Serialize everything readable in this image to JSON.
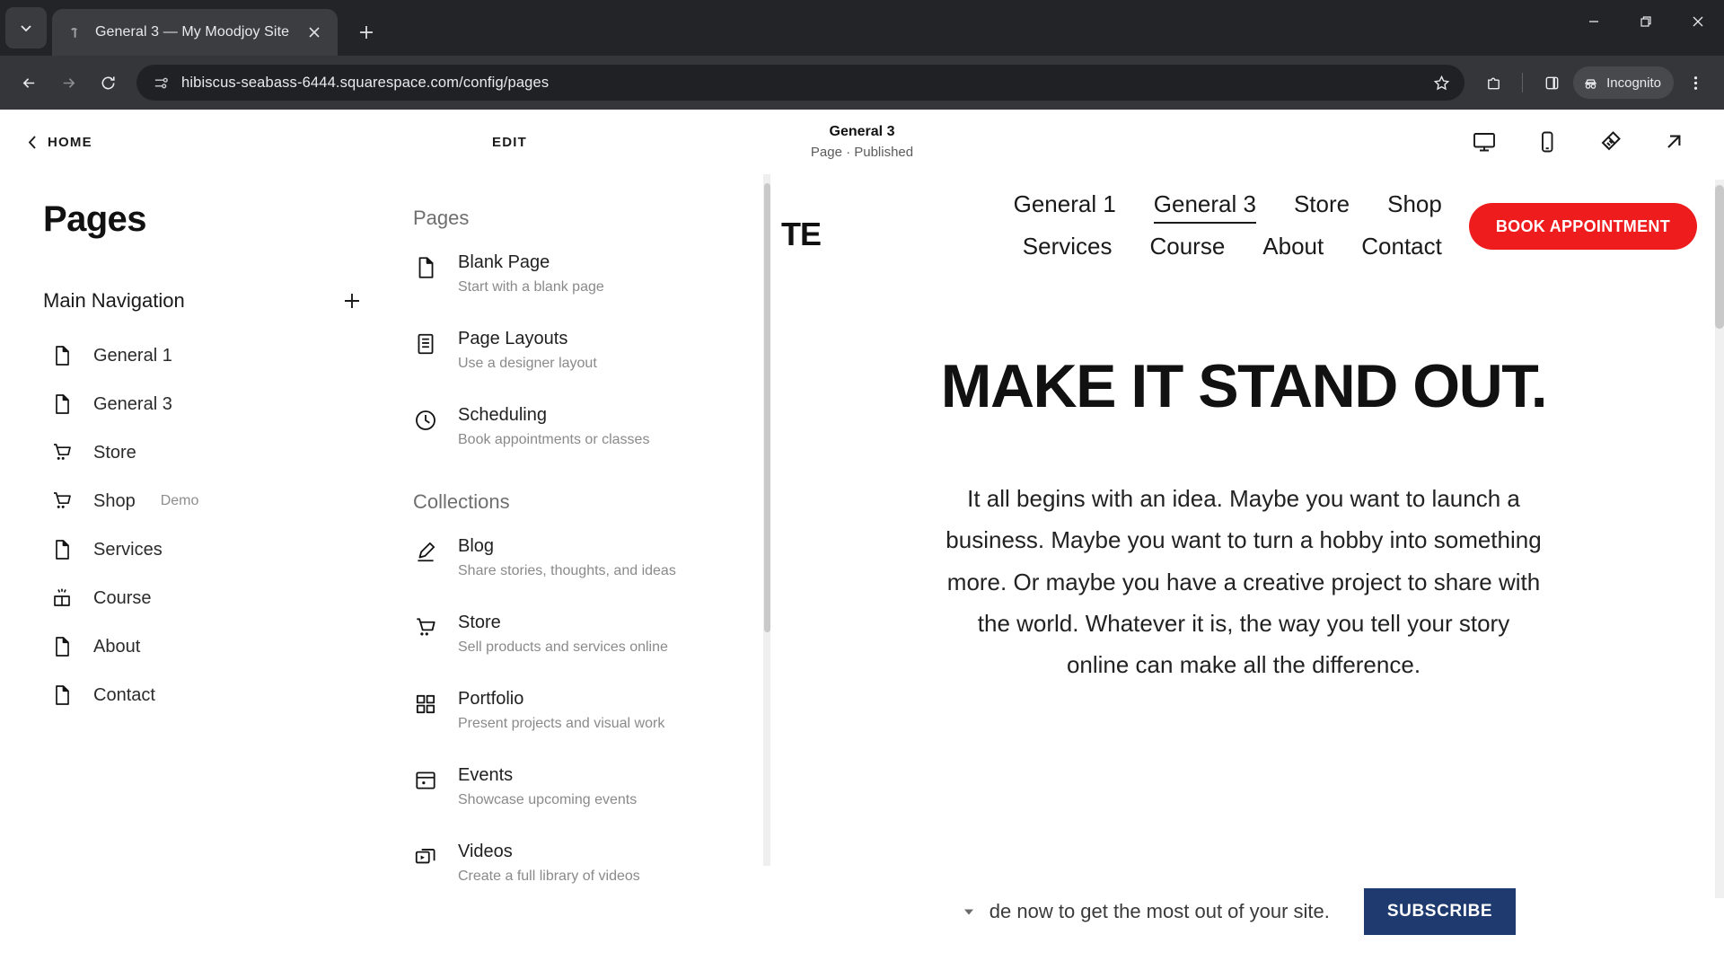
{
  "browser": {
    "tab": {
      "title": "General 3 — My Moodjoy Site",
      "favicon_name": "squarespace-favicon",
      "close_label": "×"
    },
    "new_tab_label": "+",
    "window_controls": {
      "minimize": "—",
      "maximize": "❐",
      "close": "✕"
    },
    "omnibox": {
      "url": "hibiscus-seabass-6444.squarespace.com/config/pages",
      "site_info_icon": "tune-icon",
      "bookmark_icon": "star-icon",
      "extensions_icon": "extensions-icon",
      "sidepanel_icon": "side-panel-icon"
    },
    "incognito": {
      "label": "Incognito",
      "icon": "incognito-icon"
    },
    "menu_icon": "kebab-menu-icon",
    "back_icon": "back-arrow-icon",
    "forward_icon": "forward-arrow-icon",
    "reload_icon": "reload-icon"
  },
  "sq_header": {
    "home_label": "HOME",
    "edit_label": "EDIT",
    "page_title": "General 3",
    "page_status": "Page · Published",
    "icons": [
      {
        "name": "desktop-view-icon"
      },
      {
        "name": "mobile-view-icon"
      },
      {
        "name": "site-styles-brush-icon"
      },
      {
        "name": "open-external-arrow-icon"
      }
    ]
  },
  "pages_panel": {
    "heading": "Pages",
    "nav_section_title": "Main Navigation",
    "add_label": "+",
    "items": [
      {
        "label": "General 1",
        "icon": "page-icon",
        "badge": ""
      },
      {
        "label": "General 3",
        "icon": "page-icon",
        "badge": ""
      },
      {
        "label": "Store",
        "icon": "cart-icon",
        "badge": ""
      },
      {
        "label": "Shop",
        "icon": "cart-icon",
        "badge": "Demo"
      },
      {
        "label": "Services",
        "icon": "page-icon",
        "badge": ""
      },
      {
        "label": "Course",
        "icon": "course-icon",
        "badge": ""
      },
      {
        "label": "About",
        "icon": "page-icon",
        "badge": ""
      },
      {
        "label": "Contact",
        "icon": "page-icon",
        "badge": ""
      }
    ]
  },
  "menu_panel": {
    "pages_group_title": "Pages",
    "collections_group_title": "Collections",
    "pages_items": [
      {
        "title": "Blank Page",
        "desc": "Start with a blank page",
        "icon": "page-icon"
      },
      {
        "title": "Page Layouts",
        "desc": "Use a designer layout",
        "icon": "layout-icon"
      },
      {
        "title": "Scheduling",
        "desc": "Book appointments or classes",
        "icon": "clock-icon"
      }
    ],
    "collections_items": [
      {
        "title": "Blog",
        "desc": "Share stories, thoughts, and ideas",
        "icon": "pen-icon"
      },
      {
        "title": "Store",
        "desc": "Sell products and services online",
        "icon": "cart-icon"
      },
      {
        "title": "Portfolio",
        "desc": "Present projects and visual work",
        "icon": "grid-icon"
      },
      {
        "title": "Events",
        "desc": "Showcase upcoming events",
        "icon": "calendar-icon"
      },
      {
        "title": "Videos",
        "desc": "Create a full library of videos",
        "icon": "video-icon"
      }
    ]
  },
  "site_preview": {
    "logo": "TE",
    "nav_links": [
      {
        "label": "General 1",
        "active": false
      },
      {
        "label": "General 3",
        "active": true
      },
      {
        "label": "Store",
        "active": false
      },
      {
        "label": "Shop",
        "active": false
      },
      {
        "label": "Services",
        "active": false
      },
      {
        "label": "Course",
        "active": false
      },
      {
        "label": "About",
        "active": false
      },
      {
        "label": "Contact",
        "active": false
      }
    ],
    "cta_label": "BOOK APPOINTMENT",
    "cta_color": "#ee1c1c",
    "hero_title": "MAKE IT STAND OUT.",
    "hero_body": "It all begins with an idea. Maybe you want to launch a business. Maybe you want to turn a hobby into something more. Or maybe you have a creative project to share with the world. Whatever it is, the way you tell your story online can make all the difference.",
    "subscribe_text": "de now to get the most out of your site.",
    "subscribe_button": "SUBSCRIBE",
    "subscribe_button_color": "#1e3a6e"
  }
}
